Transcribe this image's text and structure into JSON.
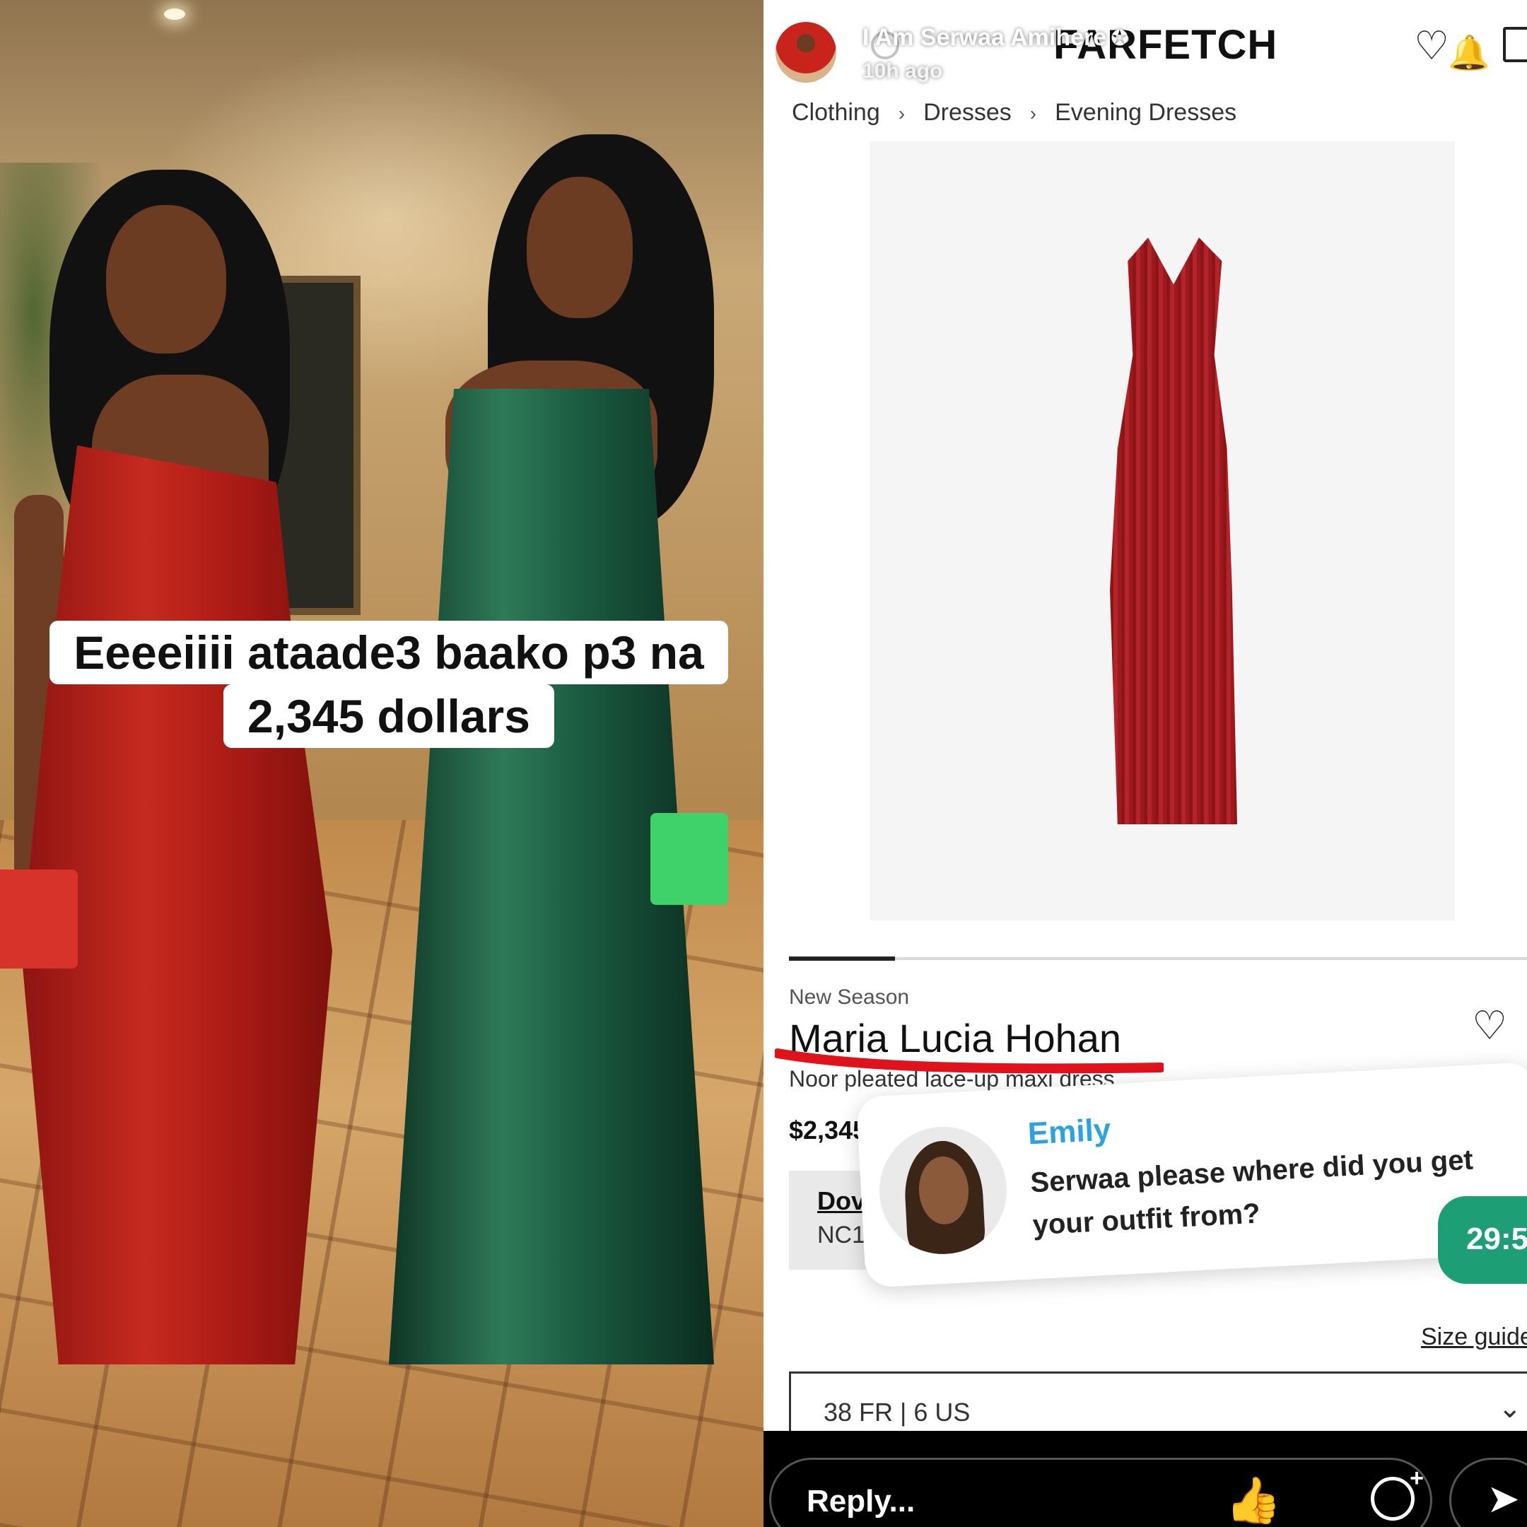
{
  "caption": {
    "line1": "Eeeeiiii ataade3 baako p3 na",
    "line2": "2,345 dollars"
  },
  "story": {
    "user": "I Am Serwaa Amihere",
    "time": "10h ago"
  },
  "store": {
    "logo": "FARFETCH",
    "breadcrumb": [
      "Clothing",
      "Dresses",
      "Evening Dresses"
    ],
    "breadcrumb_separator": "›"
  },
  "product": {
    "season_label": "New Season",
    "designer": "Maria Lucia Hohan",
    "name": "Noor pleated lace-up maxi dress",
    "price": "$2,345",
    "delivery_title": "Dov",
    "delivery_code": "NC1",
    "size_guide": "Size guide",
    "size_selected": "38 FR | 6 US",
    "annotation_color": "#e0121b"
  },
  "chat": {
    "sender": "Emily",
    "message": "Serwaa please where did you get your outfit from?",
    "timer": "29:5"
  },
  "reply_bar": {
    "placeholder": "Reply...",
    "icons": [
      "thumbs-up-icon",
      "laughing-emoji-icon",
      "sticker-add-icon",
      "send-icon"
    ]
  },
  "colors": {
    "red_dress": "#b4222a",
    "green_dress": "#2e7a58",
    "timer_green": "#1e9e74",
    "chat_name_blue": "#2aa3e0"
  }
}
